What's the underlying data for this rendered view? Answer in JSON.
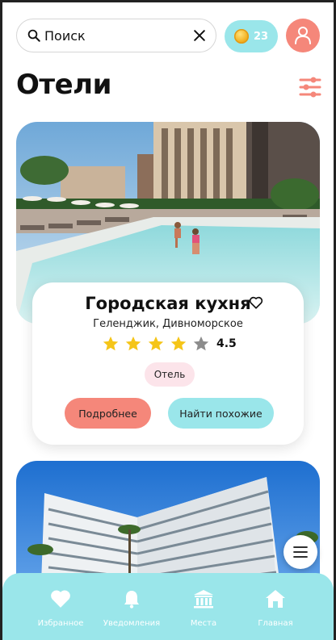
{
  "search": {
    "placeholder": "Поиск",
    "value": "Поиск"
  },
  "coins": {
    "count": "23"
  },
  "page": {
    "title": "Отели"
  },
  "hotel": {
    "name": "Городская кухня",
    "location": "Геленджик, Дивноморское",
    "rating": "4.5",
    "stars_filled": 4,
    "stars_total": 5,
    "type": "Отель",
    "more_label": "Подробнее",
    "similar_label": "Найти похожие"
  },
  "nav": {
    "favorites": "Избранное",
    "notifications": "Уведомления",
    "places": "Места",
    "home": "Главная"
  },
  "colors": {
    "accent_coral": "#f5877a",
    "accent_aqua": "#9ae6ea",
    "star_gold": "#f5c518",
    "star_gray": "#8c8c8c",
    "tag_pink": "#fce4ea"
  }
}
